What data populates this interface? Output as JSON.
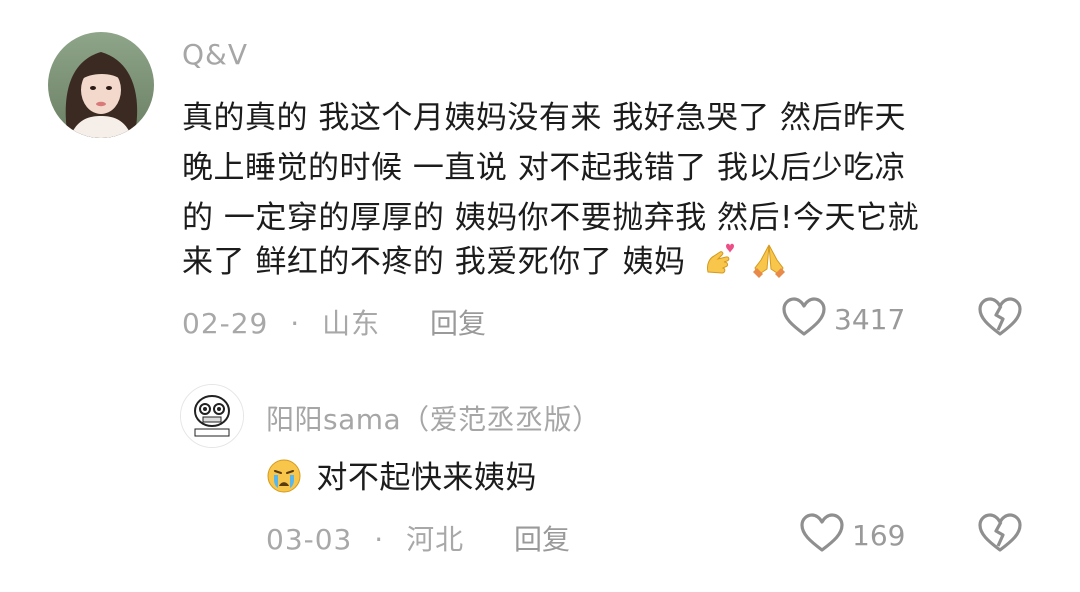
{
  "comments": [
    {
      "username": "Q&V",
      "text_lines": [
        "真的真的 我这个月姨妈没有来 我好急哭了 然后昨天",
        "晚上睡觉的时候 一直说 对不起我错了 我以后少吃凉",
        "的 一定穿的厚厚的 姨妈你不要抛弃我 然后!今天它就",
        "来了 鲜红的不疼的 我爱死你了 姨妈"
      ],
      "emojis": [
        "finger-heart-icon",
        "folded-hands-icon"
      ],
      "date": "02-29",
      "separator": "·",
      "location": "山东",
      "reply_label": "回复",
      "like_count": "3417"
    },
    {
      "username": "阳阳sama（爱范丞丞版）",
      "text": "对不起快来姨妈",
      "emojis": [
        "crying-face-icon"
      ],
      "date": "03-03",
      "separator": "·",
      "location": "河北",
      "reply_label": "回复",
      "like_count": "169"
    }
  ],
  "colors": {
    "meta_gray": "#a8a8a8",
    "text_dark": "#1c1c1c"
  }
}
